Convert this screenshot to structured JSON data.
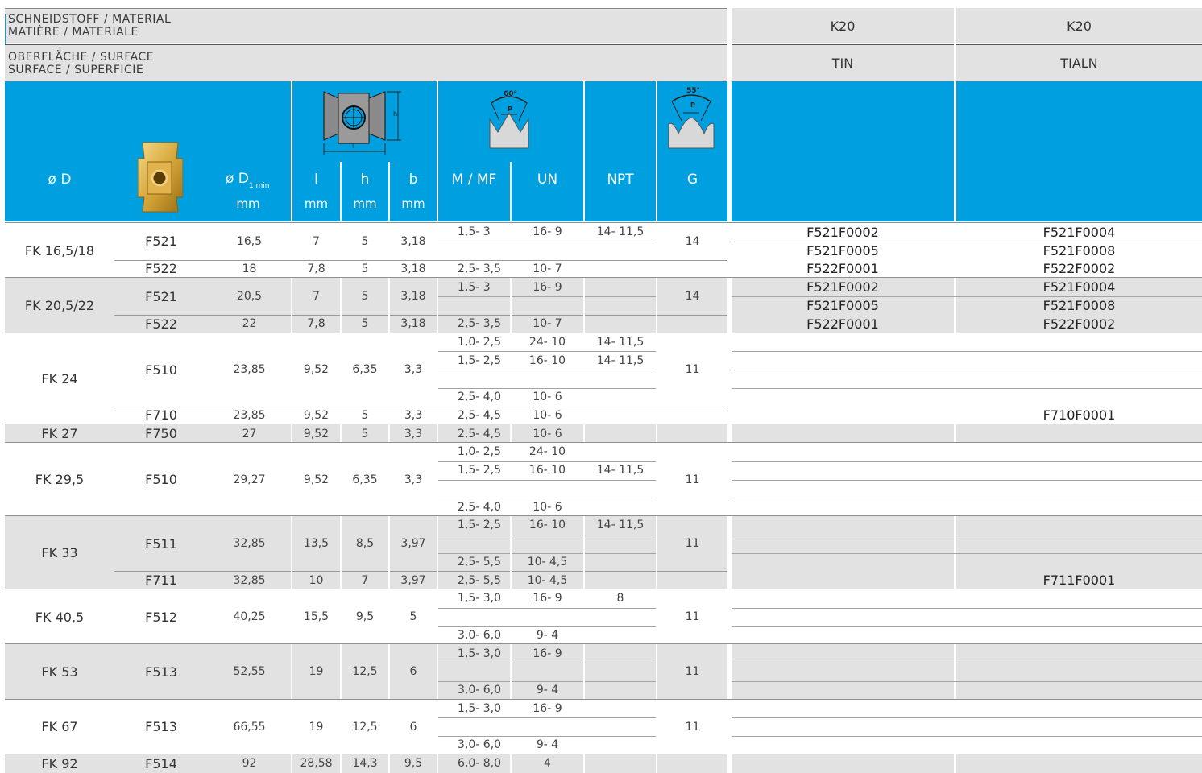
{
  "header": {
    "material_line1": "SCHNEIDSTOFF / MATERIAL",
    "material_line2": "MATIÈRE / MATERIALE",
    "surface_line1": "OBERFLÄCHE / SURFACE",
    "surface_line2": "SURFACE / SUPERFICIE",
    "grades": [
      {
        "material": "K20",
        "surface": "TIN"
      },
      {
        "material": "K20",
        "surface": "TIALN"
      }
    ]
  },
  "columns": {
    "d": "ø D",
    "d1_main": "ø D",
    "d1_sub": "1 min",
    "d1_unit": "mm",
    "l": "l",
    "l_unit": "mm",
    "h": "h",
    "h_unit": "mm",
    "b": "b",
    "b_unit": "mm",
    "m": "M / MF",
    "un": "UN",
    "npt": "NPT",
    "g": "G",
    "angle60": "60°",
    "angle55": "55°",
    "pitch": "P",
    "dim_h": "h",
    "dim_l": "l"
  },
  "icons": {
    "insert_photo": "gold-insert-icon",
    "insert_drawing": "insert-dimension-drawing-icon",
    "thread60": "thread-60-degree-icon",
    "thread55": "thread-55-degree-icon"
  },
  "colors": {
    "header_blue": "#00a0e0",
    "stripe_grey": "#e2e2e2"
  },
  "groups": [
    {
      "name": "FK 16,5/18",
      "shaded": false,
      "subs": [
        {
          "code": "F521",
          "d1": "16,5",
          "l": "7",
          "h": "5",
          "b": "3,18",
          "g": "14",
          "lines": [
            {
              "m": "1,5- 3",
              "un": "16- 9",
              "npt": "14- 11,5",
              "c1": "F521F0002",
              "c2": "F521F0004"
            },
            {
              "m": "",
              "un": "",
              "npt": "",
              "c1": "F521F0005",
              "c2": "F521F0008"
            }
          ]
        },
        {
          "code": "F522",
          "d1": "18",
          "l": "7,8",
          "h": "5",
          "b": "3,18",
          "g": "",
          "lines": [
            {
              "m": "2,5- 3,5",
              "un": "10- 7",
              "npt": "",
              "c1": "F522F0001",
              "c2": "F522F0002"
            }
          ]
        }
      ]
    },
    {
      "name": "FK 20,5/22",
      "shaded": true,
      "subs": [
        {
          "code": "F521",
          "d1": "20,5",
          "l": "7",
          "h": "5",
          "b": "3,18",
          "g": "14",
          "lines": [
            {
              "m": "1,5- 3",
              "un": "16- 9",
              "npt": "",
              "c1": "F521F0002",
              "c2": "F521F0004"
            },
            {
              "m": "",
              "un": "",
              "npt": "",
              "c1": "F521F0005",
              "c2": "F521F0008"
            }
          ]
        },
        {
          "code": "F522",
          "d1": "22",
          "l": "7,8",
          "h": "5",
          "b": "3,18",
          "g": "",
          "lines": [
            {
              "m": "2,5- 3,5",
              "un": "10- 7",
              "npt": "",
              "c1": "F522F0001",
              "c2": "F522F0002"
            }
          ]
        }
      ]
    },
    {
      "name": "FK 24",
      "shaded": false,
      "subs": [
        {
          "code": "F510",
          "d1": "23,85",
          "l": "9,52",
          "h": "6,35",
          "b": "3,3",
          "g": "11",
          "lines": [
            {
              "m": "1,0- 2,5",
              "un": "24- 10",
              "npt": "14- 11,5",
              "c1": "",
              "c2": ""
            },
            {
              "m": "1,5- 2,5",
              "un": "16- 10",
              "npt": "14- 11,5",
              "c1": "",
              "c2": ""
            },
            {
              "m": "",
              "un": "",
              "npt": "",
              "c1": "",
              "c2": ""
            },
            {
              "m": "2,5- 4,0",
              "un": "10- 6",
              "npt": "",
              "c1": "",
              "c2": ""
            }
          ]
        },
        {
          "code": "F710",
          "d1": "23,85",
          "l": "9,52",
          "h": "5",
          "b": "3,3",
          "g": "",
          "lines": [
            {
              "m": "2,5- 4,5",
              "un": "10- 6",
              "npt": "",
              "c1": "",
              "c2": "F710F0001"
            }
          ]
        }
      ]
    },
    {
      "name": "FK 27",
      "shaded": true,
      "subs": [
        {
          "code": "F750",
          "d1": "27",
          "l": "9,52",
          "h": "5",
          "b": "3,3",
          "g": "",
          "lines": [
            {
              "m": "2,5- 4,5",
              "un": "10- 6",
              "npt": "",
              "c1": "",
              "c2": ""
            }
          ]
        }
      ]
    },
    {
      "name": "FK 29,5",
      "shaded": false,
      "subs": [
        {
          "code": "F510",
          "d1": "29,27",
          "l": "9,52",
          "h": "6,35",
          "b": "3,3",
          "g": "11",
          "lines": [
            {
              "m": "1,0- 2,5",
              "un": "24- 10",
              "npt": "",
              "c1": "",
              "c2": ""
            },
            {
              "m": "1,5- 2,5",
              "un": "16- 10",
              "npt": "14- 11,5",
              "c1": "",
              "c2": ""
            },
            {
              "m": "",
              "un": "",
              "npt": "",
              "c1": "",
              "c2": ""
            },
            {
              "m": "2,5- 4,0",
              "un": "10- 6",
              "npt": "",
              "c1": "",
              "c2": ""
            }
          ]
        }
      ]
    },
    {
      "name": "FK 33",
      "shaded": true,
      "subs": [
        {
          "code": "F511",
          "d1": "32,85",
          "l": "13,5",
          "h": "8,5",
          "b": "3,97",
          "g": "11",
          "lines": [
            {
              "m": "1,5- 2,5",
              "un": "16- 10",
              "npt": "14- 11,5",
              "c1": "",
              "c2": ""
            },
            {
              "m": "",
              "un": "",
              "npt": "",
              "c1": "",
              "c2": ""
            },
            {
              "m": "2,5- 5,5",
              "un": "10- 4,5",
              "npt": "",
              "c1": "",
              "c2": ""
            }
          ]
        },
        {
          "code": "F711",
          "d1": "32,85",
          "l": "10",
          "h": "7",
          "b": "3,97",
          "g": "",
          "lines": [
            {
              "m": "2,5- 5,5",
              "un": "10- 4,5",
              "npt": "",
              "c1": "",
              "c2": "F711F0001"
            }
          ]
        }
      ]
    },
    {
      "name": "FK 40,5",
      "shaded": false,
      "subs": [
        {
          "code": "F512",
          "d1": "40,25",
          "l": "15,5",
          "h": "9,5",
          "b": "5",
          "g": "11",
          "lines": [
            {
              "m": "1,5- 3,0",
              "un": "16- 9",
              "npt": "8",
              "c1": "",
              "c2": ""
            },
            {
              "m": "",
              "un": "",
              "npt": "",
              "c1": "",
              "c2": ""
            },
            {
              "m": "3,0- 6,0",
              "un": "9- 4",
              "npt": "",
              "c1": "",
              "c2": ""
            }
          ]
        }
      ]
    },
    {
      "name": "FK 53",
      "shaded": true,
      "subs": [
        {
          "code": "F513",
          "d1": "52,55",
          "l": "19",
          "h": "12,5",
          "b": "6",
          "g": "11",
          "lines": [
            {
              "m": "1,5- 3,0",
              "un": "16- 9",
              "npt": "",
              "c1": "",
              "c2": ""
            },
            {
              "m": "",
              "un": "",
              "npt": "",
              "c1": "",
              "c2": ""
            },
            {
              "m": "3,0- 6,0",
              "un": "9- 4",
              "npt": "",
              "c1": "",
              "c2": ""
            }
          ]
        }
      ]
    },
    {
      "name": "FK 67",
      "shaded": false,
      "subs": [
        {
          "code": "F513",
          "d1": "66,55",
          "l": "19",
          "h": "12,5",
          "b": "6",
          "g": "11",
          "lines": [
            {
              "m": "1,5- 3,0",
              "un": "16- 9",
              "npt": "",
              "c1": "",
              "c2": ""
            },
            {
              "m": "",
              "un": "",
              "npt": "",
              "c1": "",
              "c2": ""
            },
            {
              "m": "3,0- 6,0",
              "un": "9- 4",
              "npt": "",
              "c1": "",
              "c2": ""
            }
          ]
        }
      ]
    },
    {
      "name": "FK 92",
      "shaded": true,
      "subs": [
        {
          "code": "F514",
          "d1": "92",
          "l": "28,58",
          "h": "14,3",
          "b": "9,5",
          "g": "",
          "lines": [
            {
              "m": "6,0- 8,0",
              "un": "4",
              "npt": "",
              "c1": "",
              "c2": ""
            }
          ]
        }
      ]
    }
  ]
}
